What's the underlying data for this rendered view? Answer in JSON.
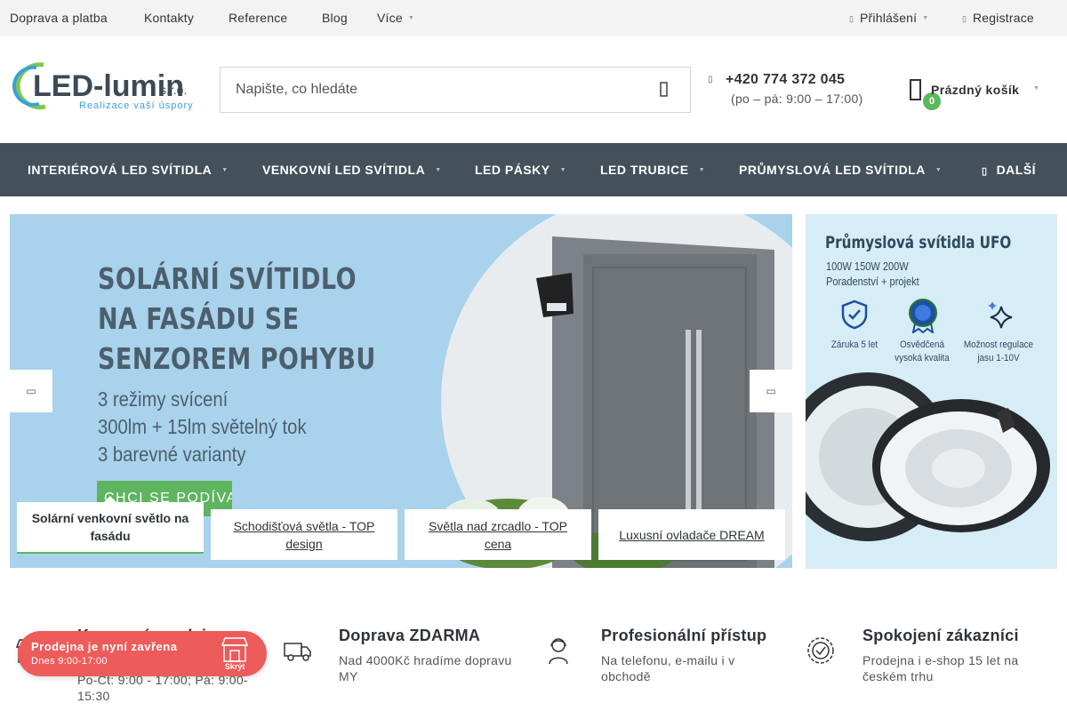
{
  "topbar": {
    "links": [
      "Doprava a platba",
      "Kontakty",
      "Reference",
      "Blog"
    ],
    "more_label": "Více",
    "login_label": "Přihlášení",
    "register_label": "Registrace"
  },
  "header": {
    "logo_text": "LED-lumin",
    "logo_suffix": "s.r.o.",
    "logo_tagline": "Realizace vaší úspory",
    "search_placeholder": "Napište, co hledáte",
    "phone": "+420 774 372 045",
    "hours": "(po – pá: 9:00 – 17:00)",
    "cart_label": "Prázdný košík",
    "cart_count": "0"
  },
  "nav": {
    "items": [
      "INTERIÉROVÁ LED SVÍTIDLA",
      "VENKOVNÍ LED SVÍTIDLA",
      "LED PÁSKY",
      "LED TRUBICE",
      "PRŮMYSLOVÁ LED SVÍTIDLA"
    ],
    "more_label": "DALŠÍ"
  },
  "slider": {
    "title_lines": [
      "SOLÁRNÍ SVÍTIDLO",
      "NA FASÁDU SE",
      "SENZOREM POHYBU"
    ],
    "sub_lines": [
      "3 režimy svícení",
      "300lm + 15lm světelný tok",
      "3 barevné varianty"
    ],
    "cta": "CHCI SE PODÍVAT",
    "tabs": [
      "Solární venkovní světlo na fasádu",
      "Schodišťová světla - TOP design",
      "Světla nad zrcadlo - TOP cena",
      "Luxusní ovladače DREAM"
    ],
    "active_tab": 0
  },
  "banner": {
    "title": "Průmyslová svítidla UFO",
    "line1": "100W 150W 200W",
    "line2": "Poradenství + projekt",
    "features": [
      "Záruka 5 let",
      "Osvědčená vysoká kvalita",
      "Možnost regulace jasu 1-10V"
    ]
  },
  "benefits": [
    {
      "icon": "store-icon",
      "title": "Kamenná prodejna",
      "text": "Po-Čt: 9:00 - 17:00; Pá: 9:00-15:30"
    },
    {
      "icon": "truck-icon",
      "title": "Doprava ZDARMA",
      "text": "Nad 4000Kč hradíme dopravu MY"
    },
    {
      "icon": "support-agent-icon",
      "title": "Profesionální přístup",
      "text": "Na telefonu, e-mailu i v obchodě"
    },
    {
      "icon": "badge-check-icon",
      "title": "Spokojení zákazníci",
      "text": "Prodejna i e-shop 15 let na českém trhu"
    }
  ],
  "store_status": {
    "title": "Prodejna je nyní zavřena",
    "hours": "Dnes 9:00-17:00",
    "hide_label": "Skrýt"
  },
  "colors": {
    "nav_bg": "#44505a",
    "accent_green": "#5cb85c",
    "store_red": "#ee5b5b",
    "topbar_bg": "#f3f3f3"
  }
}
